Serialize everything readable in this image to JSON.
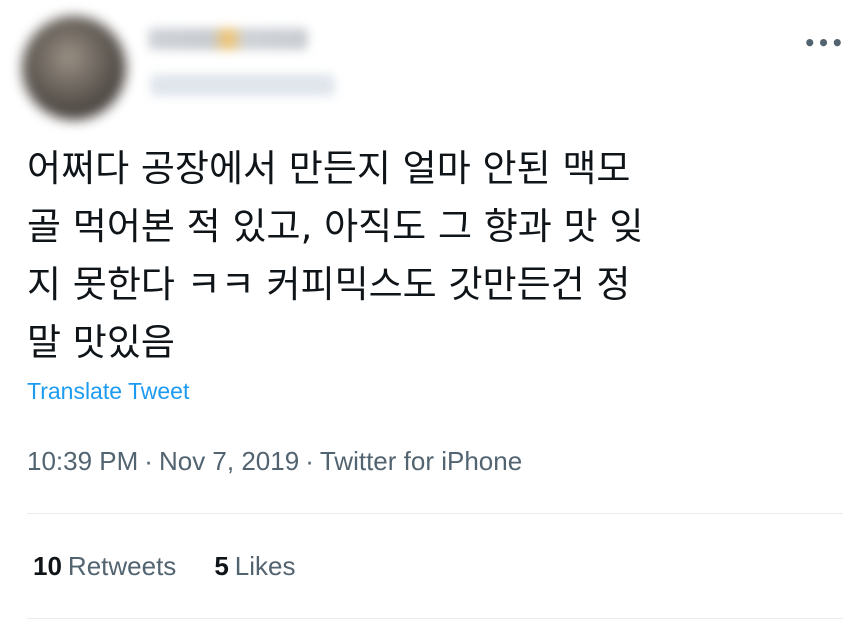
{
  "tweet": {
    "text": "어쩌다 공장에서 만든지 얼마 안된 맥모\n골 먹어본 적 있고, 아직도 그 향과 맛 잊\n지 못한다 ㅋㅋ 커피믹스도 갓만든건 정\n말 맛있음",
    "translate_label": "Translate Tweet",
    "time": "10:39 PM",
    "date": "Nov 7, 2019",
    "source": "Twitter for iPhone",
    "separator": "·"
  },
  "stats": {
    "retweets_count": "10",
    "retweets_label": "Retweets",
    "likes_count": "5",
    "likes_label": "Likes"
  },
  "icons": {
    "more": "more-horizontal-icon"
  },
  "colors": {
    "link": "#1d9bf0",
    "secondary_text": "#536471",
    "primary_text": "#0f1419"
  }
}
